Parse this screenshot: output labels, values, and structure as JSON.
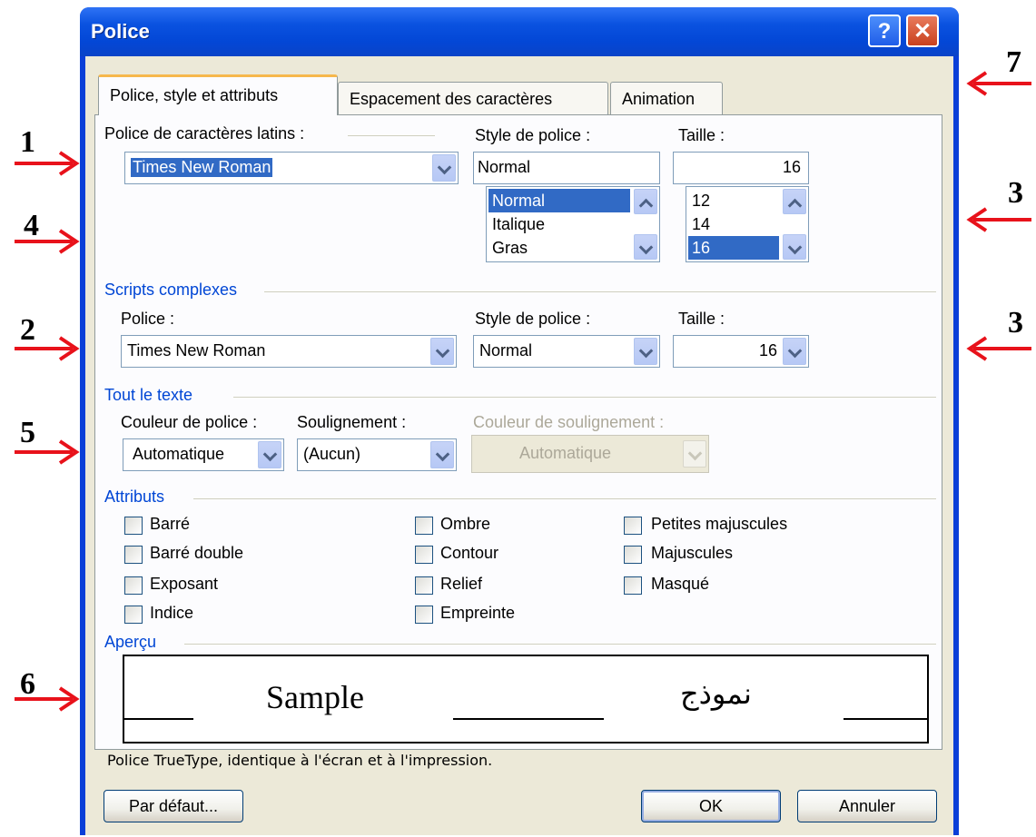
{
  "window": {
    "title": "Police"
  },
  "titlebar": {
    "help_glyph": "?",
    "close_glyph": "✕"
  },
  "tabs": [
    {
      "label": "Police, style et attributs",
      "active": true
    },
    {
      "label": "Espacement des caractères",
      "active": false
    },
    {
      "label": "Animation",
      "active": false
    }
  ],
  "latin": {
    "font_label": "Police de caractères latins :",
    "font_value": "Times New Roman",
    "style_label": "Style de police :",
    "style_value": "Normal",
    "style_list": [
      "Normal",
      "Italique",
      "Gras"
    ],
    "style_selected": "Normal",
    "size_label": "Taille :",
    "size_value": "16",
    "size_list": [
      "12",
      "14",
      "16"
    ],
    "size_selected": "16"
  },
  "complex": {
    "group_title": "Scripts complexes",
    "font_label": "Police :",
    "font_value": "Times New Roman",
    "style_label": "Style de police :",
    "style_value": "Normal",
    "size_label": "Taille :",
    "size_value": "16"
  },
  "alltext": {
    "group_title": "Tout le texte",
    "color_label": "Couleur de police :",
    "color_value": "Automatique",
    "underline_label": "Soulignement :",
    "underline_value": "(Aucun)",
    "underline_color_label": "Couleur de soulignement :",
    "underline_color_value": "Automatique"
  },
  "attributes": {
    "group_title": "Attributs",
    "col1": [
      "Barré",
      "Barré double",
      "Exposant",
      "Indice"
    ],
    "col2": [
      "Ombre",
      "Contour",
      "Relief",
      "Empreinte"
    ],
    "col3": [
      "Petites majuscules",
      "Majuscules",
      "Masqué"
    ]
  },
  "preview": {
    "group_title": "Aperçu",
    "sample_latin": "Sample",
    "sample_arabic": "نموذج",
    "note": "Police TrueType, identique à l'écran et à l'impression."
  },
  "buttons": {
    "default": "Par défaut...",
    "ok": "OK",
    "cancel": "Annuler"
  },
  "annotations": [
    "1",
    "4",
    "2",
    "5",
    "6",
    "7",
    "3",
    "3"
  ],
  "colors": {
    "arrow": "#e8121b",
    "title_bar": "#0a52e0",
    "group_title": "#0046d5",
    "selection": "#316ac5"
  }
}
